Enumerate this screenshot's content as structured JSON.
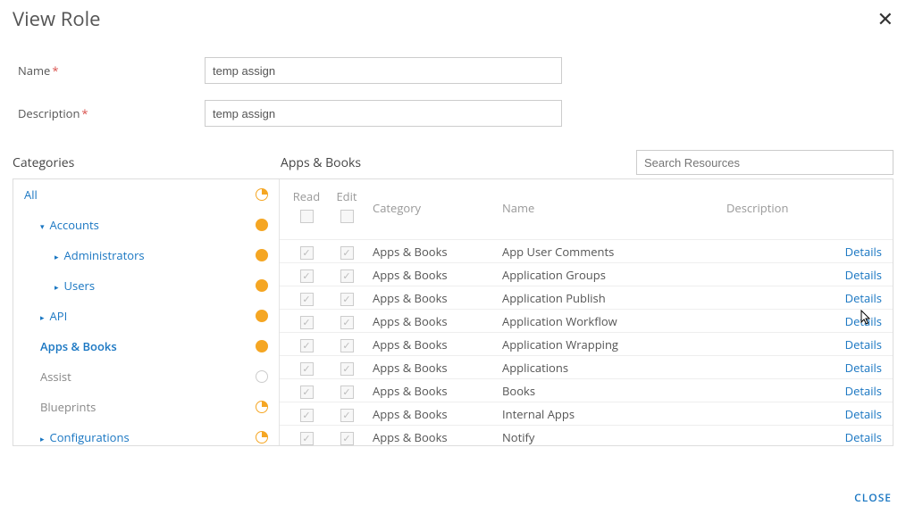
{
  "header": {
    "title": "View Role"
  },
  "form": {
    "name_label": "Name",
    "name_value": "temp assign",
    "desc_label": "Description",
    "desc_value": "temp assign"
  },
  "sections": {
    "categories_label": "Categories",
    "apps_label": "Apps & Books",
    "search_placeholder": "Search Resources"
  },
  "categories": [
    {
      "label": "All",
      "state": "quarter",
      "indent": 0,
      "caret": ""
    },
    {
      "label": "Accounts",
      "state": "full",
      "indent": 1,
      "caret": "down"
    },
    {
      "label": "Administrators",
      "state": "full",
      "indent": 2,
      "caret": "right"
    },
    {
      "label": "Users",
      "state": "full",
      "indent": 2,
      "caret": "right"
    },
    {
      "label": "API",
      "state": "full",
      "indent": 1,
      "caret": "right"
    },
    {
      "label": "Apps & Books",
      "state": "full",
      "indent": 1,
      "caret": "",
      "active": true
    },
    {
      "label": "Assist",
      "state": "empty",
      "indent": 1,
      "caret": "",
      "muted": true
    },
    {
      "label": "Blueprints",
      "state": "quarter",
      "indent": 1,
      "caret": "",
      "muted": true
    },
    {
      "label": "Configurations",
      "state": "quarter",
      "indent": 1,
      "caret": "right"
    }
  ],
  "table": {
    "headers": {
      "read": "Read",
      "edit": "Edit",
      "category": "Category",
      "name": "Name",
      "description": "Description"
    },
    "details_label": "Details",
    "rows": [
      {
        "read": true,
        "edit": true,
        "category": "Apps & Books",
        "name": "App User Comments"
      },
      {
        "read": true,
        "edit": true,
        "category": "Apps & Books",
        "name": "Application Groups"
      },
      {
        "read": true,
        "edit": true,
        "category": "Apps & Books",
        "name": "Application Publish"
      },
      {
        "read": true,
        "edit": true,
        "category": "Apps & Books",
        "name": "Application Workflow"
      },
      {
        "read": true,
        "edit": true,
        "category": "Apps & Books",
        "name": "Application Wrapping"
      },
      {
        "read": true,
        "edit": true,
        "category": "Apps & Books",
        "name": "Applications"
      },
      {
        "read": true,
        "edit": true,
        "category": "Apps & Books",
        "name": "Books"
      },
      {
        "read": true,
        "edit": true,
        "category": "Apps & Books",
        "name": "Internal Apps"
      },
      {
        "read": true,
        "edit": true,
        "category": "Apps & Books",
        "name": "Notify"
      }
    ]
  },
  "footer": {
    "close": "CLOSE"
  }
}
